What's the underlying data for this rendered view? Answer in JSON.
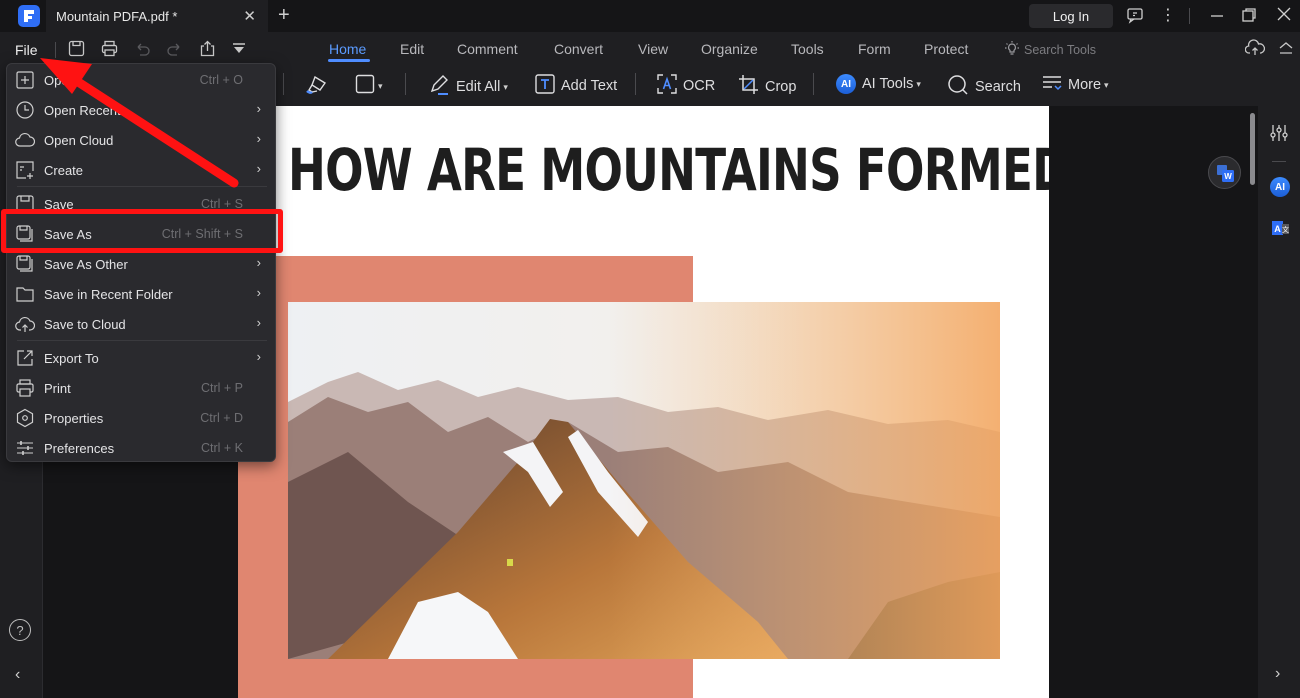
{
  "window": {
    "tab_title": "Mountain PDFA.pdf *",
    "login_label": "Log In"
  },
  "ribbon": {
    "file_label": "File",
    "tabs": [
      {
        "label": "Home",
        "active": true
      },
      {
        "label": "Edit"
      },
      {
        "label": "Comment"
      },
      {
        "label": "Convert"
      },
      {
        "label": "View"
      },
      {
        "label": "Organize"
      },
      {
        "label": "Tools"
      },
      {
        "label": "Form"
      },
      {
        "label": "Protect"
      }
    ],
    "search_tools_placeholder": "Search Tools"
  },
  "toolbar": {
    "edit_all": "Edit All",
    "add_text": "Add Text",
    "ocr": "OCR",
    "crop": "Crop",
    "ai_tools": "AI Tools",
    "search": "Search",
    "more": "More"
  },
  "file_menu": {
    "items": [
      {
        "label": "Open",
        "shortcut": "Ctrl + O",
        "icon": "plus-square-icon"
      },
      {
        "label": "Open Recent",
        "submenu": true,
        "icon": "clock-icon"
      },
      {
        "label": "Open Cloud",
        "submenu": true,
        "icon": "cloud-icon"
      },
      {
        "label": "Create",
        "submenu": true,
        "icon": "create-doc-icon"
      },
      {
        "label": "Save",
        "shortcut": "Ctrl + S",
        "icon": "save-icon"
      },
      {
        "label": "Save As",
        "shortcut": "Ctrl + Shift + S",
        "icon": "save-as-icon",
        "highlighted": true
      },
      {
        "label": "Save As Other",
        "submenu": true,
        "icon": "save-as-other-icon"
      },
      {
        "label": "Save in Recent Folder",
        "submenu": true,
        "icon": "folder-icon"
      },
      {
        "label": "Save to Cloud",
        "submenu": true,
        "icon": "cloud-upload-icon"
      },
      {
        "label": "Export To",
        "submenu": true,
        "icon": "export-icon"
      },
      {
        "label": "Print",
        "shortcut": "Ctrl + P",
        "icon": "print-icon"
      },
      {
        "label": "Properties",
        "shortcut": "Ctrl + D",
        "icon": "properties-icon"
      },
      {
        "label": "Preferences",
        "shortcut": "Ctrl + K",
        "icon": "preferences-icon"
      }
    ]
  },
  "document": {
    "title": "HOW ARE MOUNTAINS FORMED?"
  },
  "rightbar": {
    "ai_label": "AI"
  },
  "sidebar": {
    "help": "?"
  },
  "colors": {
    "accent": "#4f8dff",
    "highlight": "#ff1212",
    "salmon": "#e08670"
  }
}
